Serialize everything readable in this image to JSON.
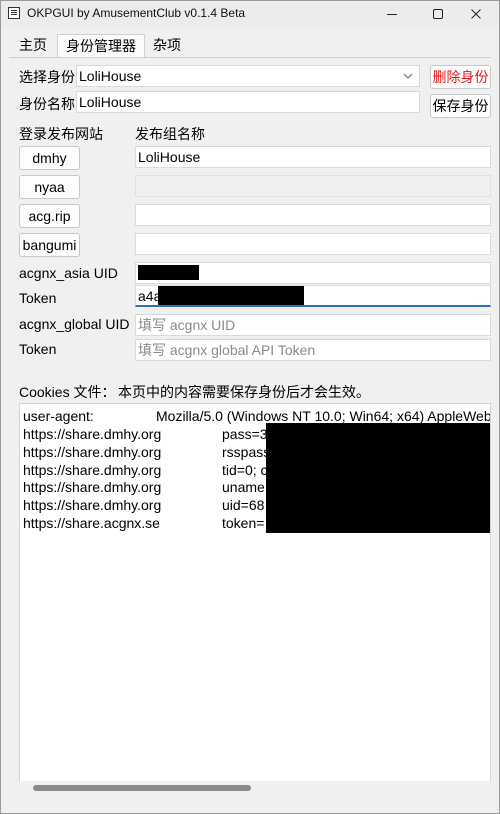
{
  "window": {
    "title": "OKPGUI by AmusementClub v0.1.4 Beta"
  },
  "tabs": [
    {
      "label": "主页"
    },
    {
      "label": "身份管理器"
    },
    {
      "label": "杂项"
    }
  ],
  "identity": {
    "select_label": "选择身份",
    "select_value": "LoliHouse",
    "delete_button": "删除身份",
    "name_label": "身份名称",
    "name_value": "LoliHouse",
    "save_button": "保存身份"
  },
  "sites": {
    "header_sites": "登录发布网站",
    "header_group": "发布组名称",
    "rows": [
      {
        "button": "dmhy",
        "value": "LoliHouse"
      },
      {
        "button": "nyaa",
        "value": ""
      },
      {
        "button": "acg.rip",
        "value": ""
      },
      {
        "button": "bangumi",
        "value": ""
      }
    ]
  },
  "acgnx": {
    "asia_uid_label": "acgnx_asia UID",
    "asia_token_label": "Token",
    "asia_token_value": "a4a",
    "global_uid_label": "acgnx_global UID",
    "global_uid_placeholder": "填写 acgnx UID",
    "global_token_label": "Token",
    "global_token_placeholder": "填写 acgnx global API Token"
  },
  "cookies": {
    "label": "Cookies 文件：",
    "note": "本页中的内容需要保存身份后才会生效。",
    "lines": [
      {
        "left": "user-agent:",
        "right": "Mozilla/5.0 (Windows NT 10.0; Win64; x64) AppleWeb"
      },
      {
        "left": "https://share.dmhy.org",
        "right": "pass=3"
      },
      {
        "left": "https://share.dmhy.org",
        "right": "rsspass"
      },
      {
        "left": "https://share.dmhy.org",
        "right": "tid=0; c"
      },
      {
        "left": "https://share.dmhy.org",
        "right": "uname"
      },
      {
        "left": "https://share.dmhy.org",
        "right": "uid=68"
      },
      {
        "left": "https://share.acgnx.se",
        "right": "token="
      }
    ]
  }
}
